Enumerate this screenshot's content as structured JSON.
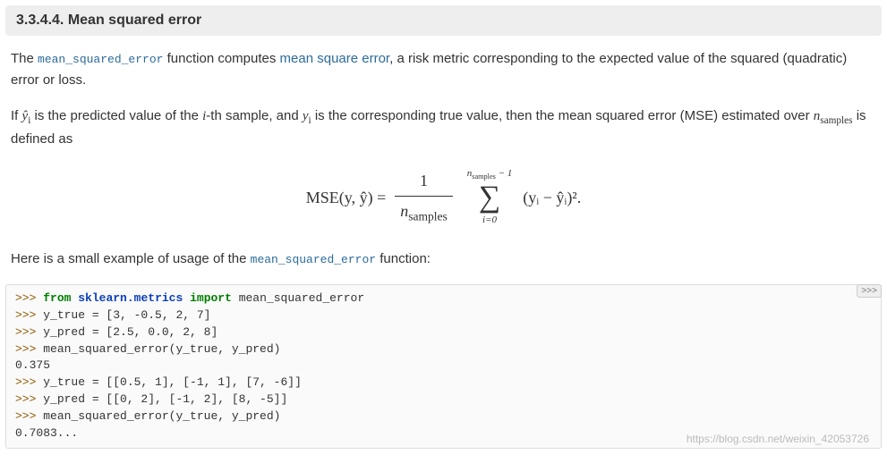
{
  "header": {
    "title": "3.3.4.4. Mean squared error"
  },
  "intro": {
    "t1": "The ",
    "fn": "mean_squared_error",
    "t2": " function computes ",
    "link": "mean square error",
    "t3": ", a risk metric corresponding to the expected value of the squared (quadratic) error or loss."
  },
  "para2": {
    "t1": "If ",
    "yhat": "ŷ",
    "yhat_sub": "i",
    "t2": " is the predicted value of the ",
    "i": "i",
    "t3": "-th sample, and ",
    "yi": "y",
    "yi_sub": "i",
    "t4": " is the corresponding true value, then the mean squared error (MSE) estimated over ",
    "nsamp": "n",
    "nsamp_sub": "samples",
    "t5": " is defined as"
  },
  "formula": {
    "lhs": "MSE(y, ŷ) =",
    "frac_num": "1",
    "frac_den_n": "n",
    "frac_den_sub": "samples",
    "sum_top_n": "n",
    "sum_top_sub": "samples",
    "sum_top_tail": " − 1",
    "sum_bot": "i=0",
    "term": "(yᵢ − ŷᵢ)².",
    "sigma": "∑"
  },
  "para3": {
    "t1": "Here is a small example of usage of the ",
    "fn": "mean_squared_error",
    "t2": " function:"
  },
  "code": {
    "copy": ">>>",
    "p": ">>> ",
    "l1_k1": "from",
    "l1_mod": "sklearn.metrics",
    "l1_k2": "import",
    "l1_rest": " mean_squared_error",
    "l2": "y_true = [3, -0.5, 2, 7]",
    "l3": "y_pred = [2.5, 0.0, 2, 8]",
    "l4": "mean_squared_error(y_true, y_pred)",
    "l5": "0.375",
    "l6": "y_true = [[0.5, 1], [-1, 1], [7, -6]]",
    "l7": "y_pred = [[0, 2], [-1, 2], [8, -5]]",
    "l8": "mean_squared_error(y_true, y_pred)",
    "l9": "0.7083..."
  },
  "watermark": "https://blog.csdn.net/weixin_42053726"
}
